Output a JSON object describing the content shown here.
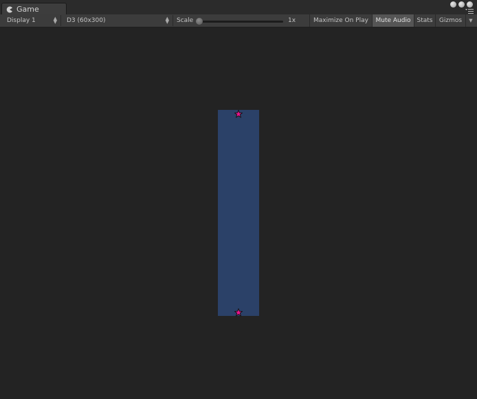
{
  "tab": {
    "label": "Game"
  },
  "toolbar": {
    "display": "Display 1",
    "resolution": "D3 (60x300)",
    "scale_label": "Scale",
    "scale_value": "1x",
    "maximize_on_play": "Maximize On Play",
    "mute_audio": "Mute Audio",
    "stats": "Stats",
    "gizmos": "Gizmos"
  },
  "game_view": {
    "background": "#2b4168",
    "marker_color": "#e8148c"
  }
}
